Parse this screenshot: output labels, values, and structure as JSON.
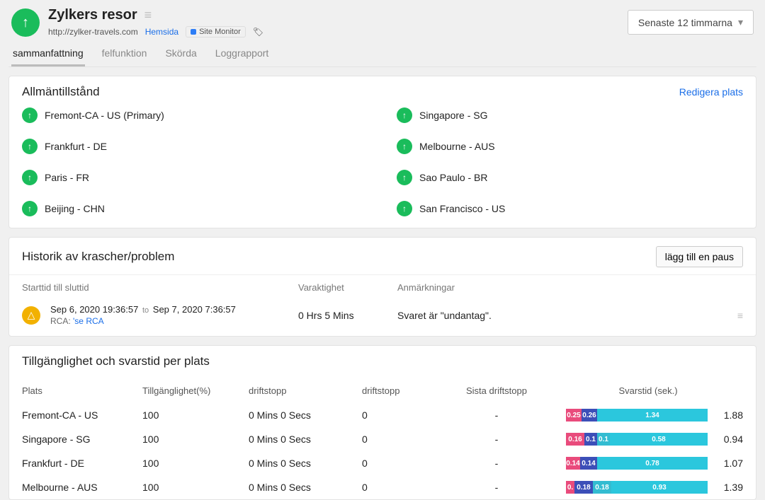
{
  "header": {
    "title": "Zylkers resor",
    "url": "http://zylker-travels.com",
    "homepage_label": "Hemsida",
    "monitor_badge": "Site Monitor",
    "timerange": "Senaste 12 timmarna"
  },
  "tabs": [
    {
      "label": "sammanfattning",
      "active": true
    },
    {
      "label": "felfunktion",
      "active": false
    },
    {
      "label": "Skörda",
      "active": false
    },
    {
      "label": "Loggrapport",
      "active": false
    }
  ],
  "general_status": {
    "title": "Allmäntillstånd",
    "edit_label": "Redigera plats",
    "locations_left": [
      "Fremont-CA - US (Primary)",
      "Frankfurt - DE",
      "Paris - FR",
      "Beijing - CHN"
    ],
    "locations_right": [
      "Singapore - SG",
      "Melbourne - AUS",
      "Sao Paulo - BR",
      "San Francisco - US"
    ]
  },
  "history": {
    "title": "Historik av krascher/problem",
    "pause_label": "lägg till en paus",
    "columns": {
      "start": "Starttid till sluttid",
      "duration": "Varaktighet",
      "remarks": "Anmärkningar"
    },
    "row": {
      "start": "Sep 6, 2020 19:36:57",
      "to": "to",
      "end": "Sep 7, 2020 7:36:57",
      "rca_prefix": "RCA:",
      "rca_link": "'se RCA",
      "duration": "0 Hrs 5 Mins",
      "remarks": "Svaret är \"undantag\"."
    }
  },
  "availability": {
    "title": "Tillgänglighet och svarstid per plats",
    "columns": {
      "loc": "Plats",
      "avail": "Tillgänglighet(%)",
      "down": "driftstopp",
      "count": "driftstopp",
      "last": "Sista driftstopp",
      "rt": "Svarstid (sek.)"
    },
    "rows": [
      {
        "loc": "Fremont-CA - US",
        "avail": "100",
        "down": "0 Mins 0 Secs",
        "count": "0",
        "last": "-",
        "segs": [
          "0.25",
          "0.26",
          "",
          "1.34"
        ],
        "total": "1.88",
        "widths": [
          22,
          22,
          0,
          156
        ]
      },
      {
        "loc": "Singapore - SG",
        "avail": "100",
        "down": "0 Mins 0 Secs",
        "count": "0",
        "last": "-",
        "segs": [
          "0.16",
          "0.1",
          "0.1",
          "0.58"
        ],
        "total": "0.94",
        "widths": [
          26,
          18,
          18,
          138
        ]
      },
      {
        "loc": "Frankfurt - DE",
        "avail": "100",
        "down": "0 Mins 0 Secs",
        "count": "0",
        "last": "-",
        "segs": [
          "0.14",
          "0.14",
          "",
          "0.78"
        ],
        "total": "1.07",
        "widths": [
          20,
          24,
          0,
          156
        ]
      },
      {
        "loc": "Melbourne - AUS",
        "avail": "100",
        "down": "0 Mins 0 Secs",
        "count": "0",
        "last": "-",
        "segs": [
          "0.",
          "0.18",
          "0.18",
          "0.93"
        ],
        "total": "1.39",
        "widths": [
          12,
          26,
          26,
          136
        ]
      }
    ]
  }
}
